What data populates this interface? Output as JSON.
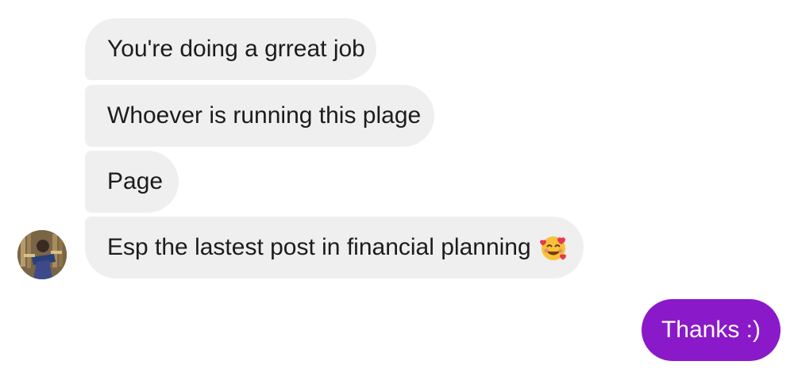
{
  "messages": {
    "incoming": [
      {
        "text": "You're doing a grreat job"
      },
      {
        "text": "Whoever is running this plage"
      },
      {
        "text": "Page"
      },
      {
        "text": "Esp the lastest post in financial planning",
        "emoji": "smiling-face-with-hearts-icon"
      }
    ],
    "outgoing": [
      {
        "text": "Thanks :)"
      }
    ]
  },
  "colors": {
    "incoming_bubble": "#efefef",
    "outgoing_bubble": "#8a19c9",
    "text_dark": "#1c1c1c",
    "text_light": "#ffffff"
  },
  "sender": {
    "avatar": "person-photo-avatar"
  }
}
